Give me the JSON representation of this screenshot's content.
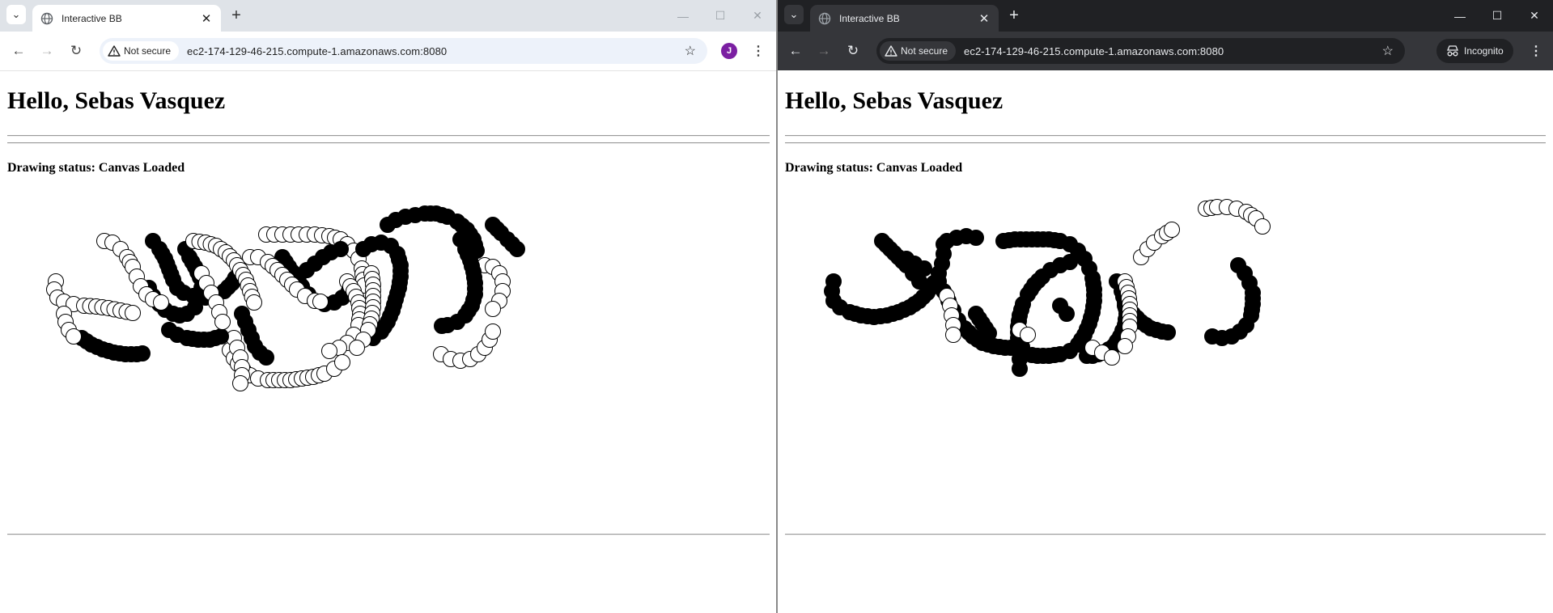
{
  "windows": [
    {
      "theme": "light",
      "tab": {
        "title": "Interactive BB"
      },
      "address": {
        "security_label": "Not secure",
        "url": "ec2-174-129-46-215.compute-1.amazonaws.com:8080"
      },
      "profile_initial": "J",
      "page": {
        "greeting": "Hello, Sebas Vasquez",
        "status": "Drawing status: Canvas Loaded"
      }
    },
    {
      "theme": "dark",
      "tab": {
        "title": "Interactive BB"
      },
      "address": {
        "security_label": "Not secure",
        "url": "ec2-174-129-46-215.compute-1.amazonaws.com:8080"
      },
      "incognito_label": "Incognito",
      "page": {
        "greeting": "Hello, Sebas Vasquez",
        "status": "Drawing status: Canvas Loaded"
      }
    }
  ]
}
